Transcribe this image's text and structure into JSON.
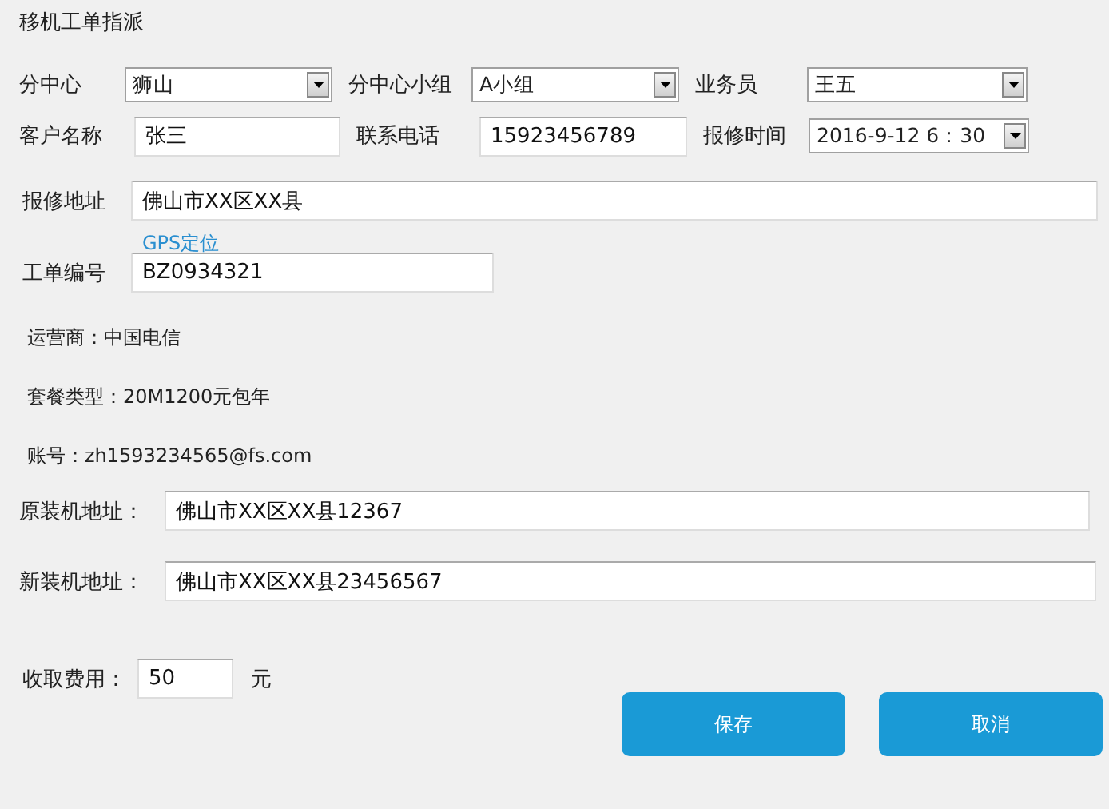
{
  "title": "移机工单指派",
  "top_rows": [
    [
      {
        "kind": "select",
        "label": "分中心",
        "value": "狮山"
      },
      {
        "kind": "select",
        "label": "分中心小组",
        "value": "A小组"
      },
      {
        "kind": "select",
        "label": "业务员",
        "value": "王五"
      }
    ],
    [
      {
        "kind": "input",
        "label": "客户名称",
        "value": "张三"
      },
      {
        "kind": "input",
        "label": "联系电话",
        "value": "15923456789"
      },
      {
        "kind": "select",
        "label": "报修时间",
        "value": "2016-9-12 6：30"
      }
    ]
  ],
  "repair_address": {
    "label": "报修地址",
    "value": "佛山市XX区XX县"
  },
  "gps_link": "GPS定位",
  "order_number": {
    "label": "工单编号",
    "value": "BZ0934321"
  },
  "info_lines": [
    "运营商：中国电信",
    "套餐类型：20M1200元包年",
    "账号：zh1593234565@fs.com"
  ],
  "addresses": [
    {
      "label": "原装机地址：",
      "value": "佛山市XX区XX县12367"
    },
    {
      "label": "新装机地址：",
      "value": "佛山市XX区XX县23456567"
    }
  ],
  "fee": {
    "label": "收取费用：",
    "value": "50",
    "unit": "元"
  },
  "buttons": [
    "保存",
    "取消"
  ]
}
